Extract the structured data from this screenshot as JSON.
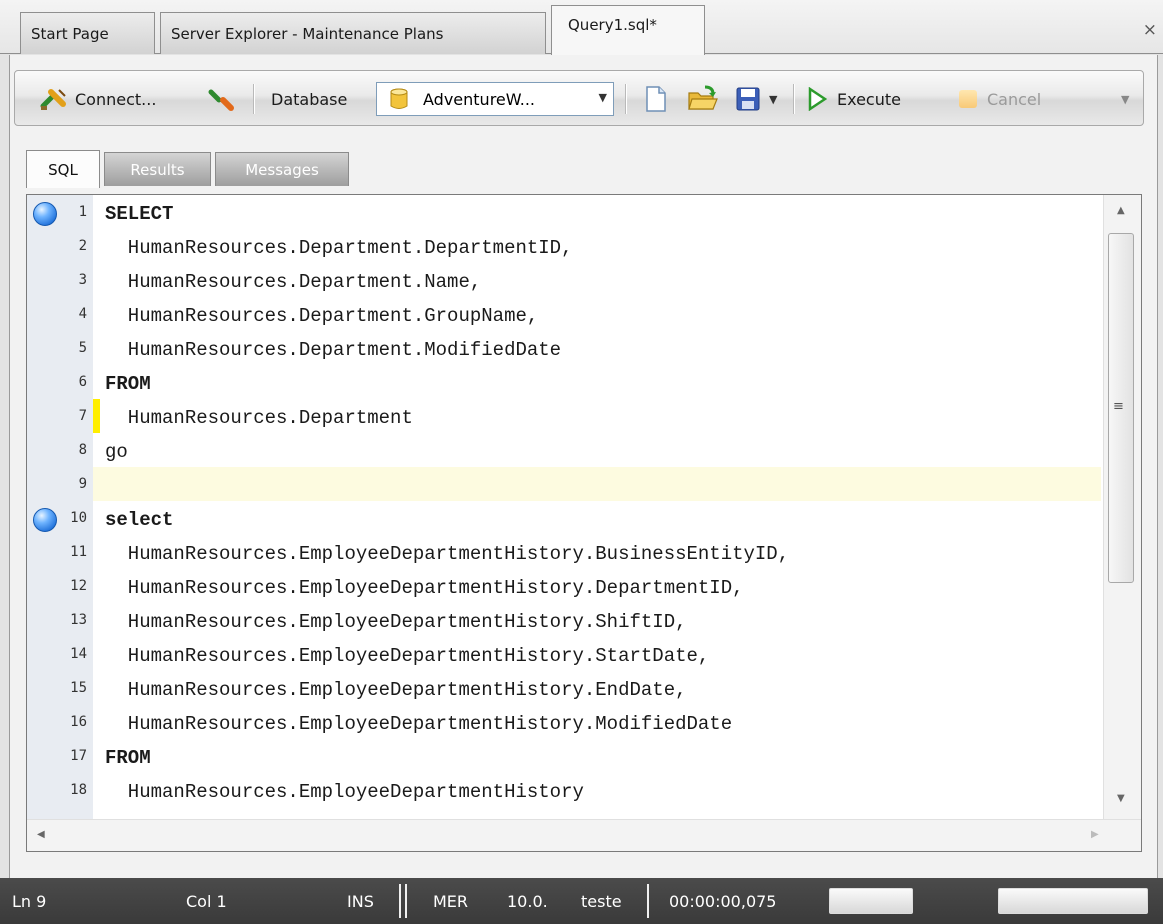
{
  "doc_tabs": {
    "start_page": "Start Page",
    "server_explorer": "Server Explorer - Maintenance Plans",
    "query": "Query1.sql*",
    "close": "×"
  },
  "toolbar": {
    "connect": "Connect...",
    "database_label": "Database",
    "database_value": "AdventureW...",
    "execute": "Execute",
    "cancel": "Cancel"
  },
  "sub_tabs": {
    "sql": "SQL",
    "results": "Results",
    "messages": "Messages"
  },
  "editor": {
    "line_numbers": [
      "1",
      "2",
      "3",
      "4",
      "5",
      "6",
      "7",
      "8",
      "9",
      "10",
      "11",
      "12",
      "13",
      "14",
      "15",
      "16",
      "17",
      "18"
    ],
    "lines": [
      "SELECT",
      "  HumanResources.Department.DepartmentID,",
      "  HumanResources.Department.Name,",
      "  HumanResources.Department.GroupName,",
      "  HumanResources.Department.ModifiedDate",
      "FROM",
      "  HumanResources.Department",
      "go",
      "",
      "select",
      "  HumanResources.EmployeeDepartmentHistory.BusinessEntityID,",
      "  HumanResources.EmployeeDepartmentHistory.DepartmentID,",
      "  HumanResources.EmployeeDepartmentHistory.ShiftID,",
      "  HumanResources.EmployeeDepartmentHistory.StartDate,",
      "  HumanResources.EmployeeDepartmentHistory.EndDate,",
      "  HumanResources.EmployeeDepartmentHistory.ModifiedDate",
      "FROM",
      "  HumanResources.EmployeeDepartmentHistory"
    ]
  },
  "status": {
    "ln": "Ln 9",
    "col": "Col 1",
    "ins": "INS",
    "mer": "MER",
    "ver": "10.0.",
    "db": "teste",
    "time": "00:00:00,075"
  },
  "colors": {
    "breakpoint": "#1e6fd9",
    "change_marker": "#ffee00",
    "current_line": "#fdfbe0",
    "status_bg": "#3f3f3f"
  }
}
